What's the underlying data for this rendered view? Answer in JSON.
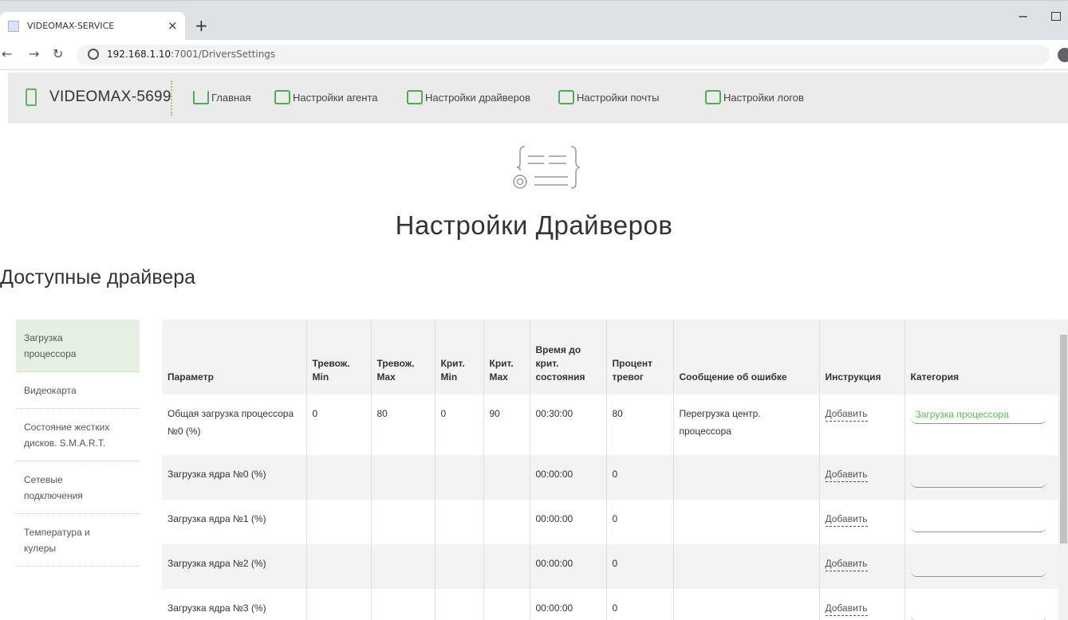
{
  "browser": {
    "tab_title": "VIDEOMAX-SERVICE",
    "close_glyph": "×",
    "new_tab_glyph": "+",
    "min_glyph": "−",
    "url_host": "192.168.1.10",
    "url_rest": ":7001/DriversSettings"
  },
  "header": {
    "brand": "VIDEOMAX-5699",
    "nav": [
      {
        "label": "Главная",
        "icon": "home-icon"
      },
      {
        "label": "Настройки агента",
        "icon": "agent-settings-icon"
      },
      {
        "label": "Настройки драйверов",
        "icon": "driver-settings-icon"
      },
      {
        "label": "Настройки почты",
        "icon": "mail-settings-icon"
      },
      {
        "label": "Настройки логов",
        "icon": "log-settings-icon"
      }
    ]
  },
  "page": {
    "title": "Настройки Драйверов",
    "section": "Доступные драйвера"
  },
  "sidebar": {
    "items": [
      {
        "label": "Загрузка процессора",
        "active": true
      },
      {
        "label": "Видеокарта"
      },
      {
        "label": "Состояние жестких дисков. S.M.A.R.T."
      },
      {
        "label": "Сетевые подключения"
      },
      {
        "label": "Температура и кулеры"
      }
    ]
  },
  "table": {
    "headers": {
      "param": "Параметр",
      "warn_min": "Тревож. Min",
      "warn_max": "Тревож. Max",
      "crit_min": "Крит. Min",
      "crit_max": "Крит. Max",
      "time_to_crit": "Время до крит. состояния",
      "alarm_pct": "Процент тревог",
      "error_msg": "Сообщение об ошибке",
      "instruction": "Инструкция",
      "category": "Категория"
    },
    "rows": [
      {
        "param": "Общая загрузка процессора №0 (%)",
        "warn_min": "0",
        "warn_max": "80",
        "crit_min": "0",
        "crit_max": "90",
        "time": "00:30:00",
        "pct": "80",
        "msg": "Перегрузка центр. процессора",
        "instruction": "Добавить",
        "category": "Загрузка процессора"
      },
      {
        "param": "Загрузка ядра №0 (%)",
        "warn_min": "",
        "warn_max": "",
        "crit_min": "",
        "crit_max": "",
        "time": "00:00:00",
        "pct": "0",
        "msg": "",
        "instruction": "Добавить",
        "category": ""
      },
      {
        "param": "Загрузка ядра №1 (%)",
        "warn_min": "",
        "warn_max": "",
        "crit_min": "",
        "crit_max": "",
        "time": "00:00:00",
        "pct": "0",
        "msg": "",
        "instruction": "Добавить",
        "category": ""
      },
      {
        "param": "Загрузка ядра №2 (%)",
        "warn_min": "",
        "warn_max": "",
        "crit_min": "",
        "crit_max": "",
        "time": "00:00:00",
        "pct": "0",
        "msg": "",
        "instruction": "Добавить",
        "category": ""
      },
      {
        "param": "Загрузка ядра №3 (%)",
        "warn_min": "",
        "warn_max": "",
        "crit_min": "",
        "crit_max": "",
        "time": "00:00:00",
        "pct": "0",
        "msg": "",
        "instruction": "Добавить",
        "category": ""
      }
    ]
  },
  "colors": {
    "accent": "#5cb85c",
    "header_bg": "#ebebeb",
    "active_menu_bg": "#e6f0e2"
  }
}
